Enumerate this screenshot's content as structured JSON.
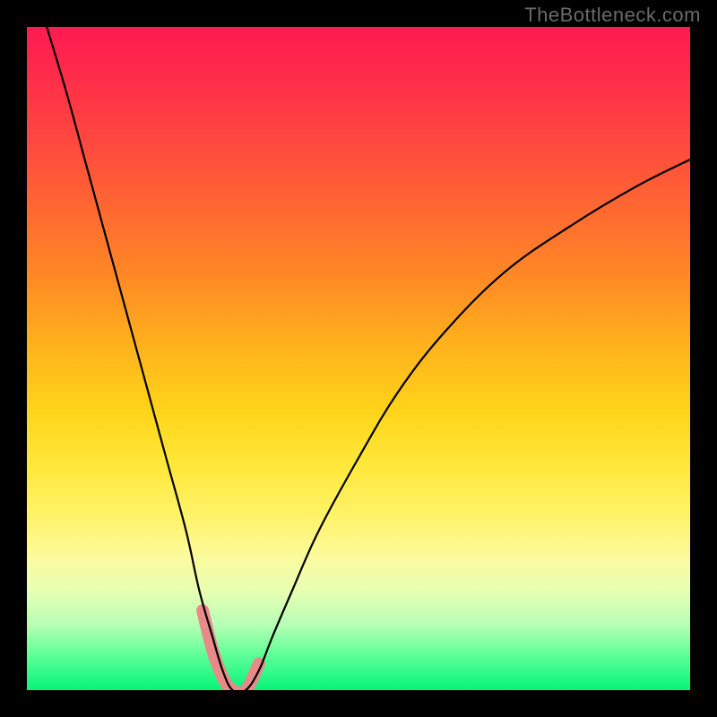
{
  "watermark": "TheBottleneck.com",
  "chart_data": {
    "type": "line",
    "title": "",
    "xlabel": "",
    "ylabel": "",
    "xlim": [
      0,
      100
    ],
    "ylim": [
      0,
      100
    ],
    "gradient_stops": [
      {
        "pos": 0,
        "color": "#ff1a52"
      },
      {
        "pos": 18,
        "color": "#ff4a3e"
      },
      {
        "pos": 38,
        "color": "#ff8a25"
      },
      {
        "pos": 58,
        "color": "#ffd41a"
      },
      {
        "pos": 74,
        "color": "#fff36a"
      },
      {
        "pos": 85,
        "color": "#e8ffb2"
      },
      {
        "pos": 95,
        "color": "#5aff96"
      },
      {
        "pos": 100,
        "color": "#06f47a"
      }
    ],
    "series": [
      {
        "name": "bottleneck-curve",
        "stroke": "#000000",
        "x": [
          3,
          6,
          9,
          12,
          15,
          18,
          21,
          24,
          26,
          28,
          29.5,
          31,
          33,
          35,
          37,
          40,
          44,
          50,
          56,
          63,
          72,
          82,
          92,
          100
        ],
        "y": [
          100,
          90,
          79,
          68,
          57,
          46,
          35,
          24,
          15,
          8,
          3,
          0,
          0,
          3,
          8,
          15,
          24,
          35,
          45,
          54,
          63,
          70,
          76,
          80
        ]
      },
      {
        "name": "highlight-segment",
        "stroke": "#e78a8a",
        "stroke_width": 12,
        "x": [
          26.5,
          28,
          29.5,
          31,
          33,
          35
        ],
        "y": [
          12,
          6,
          2,
          0,
          0,
          4
        ]
      }
    ]
  }
}
